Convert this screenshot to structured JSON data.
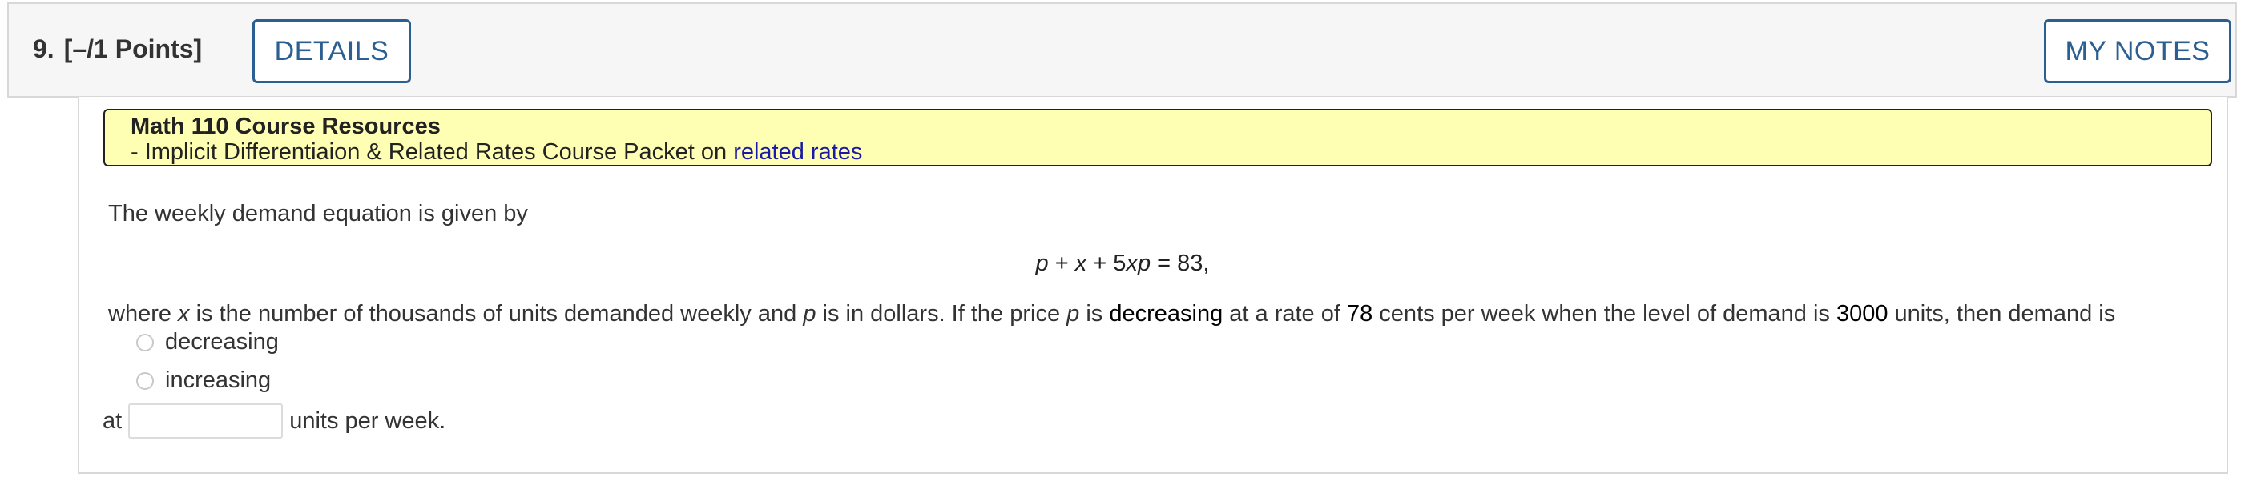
{
  "header": {
    "number": "9.",
    "points": "[–/1 Points]",
    "details_label": "DETAILS",
    "notes_label": "MY NOTES"
  },
  "resources": {
    "title": "Math 110 Course Resources",
    "line_prefix": "- Implicit Differentiaion & Related Rates Course Packet on ",
    "link_text": "related rates"
  },
  "question": {
    "intro": "The weekly demand equation is given by",
    "equation": {
      "p": "p",
      "plus1": " + ",
      "x": "x",
      "plus2": " + 5",
      "xp": "xp",
      "rest": " = 83,"
    },
    "problem": {
      "t1": "where ",
      "x": "x",
      "t2": " is the number of thousands of units demanded weekly and ",
      "p1": "p",
      "t3": " is in dollars. If the price ",
      "p2": "p",
      "t4": " is ",
      "direction": "decreasing",
      "t5": " at a rate of ",
      "rate": "78",
      "t6": " cents per week when the level of demand is ",
      "demand": "3000",
      "t7": " units, then demand is"
    },
    "options": [
      "decreasing",
      "increasing"
    ],
    "answer_prefix": "at",
    "answer_suffix": "units per week.",
    "answer_value": ""
  }
}
